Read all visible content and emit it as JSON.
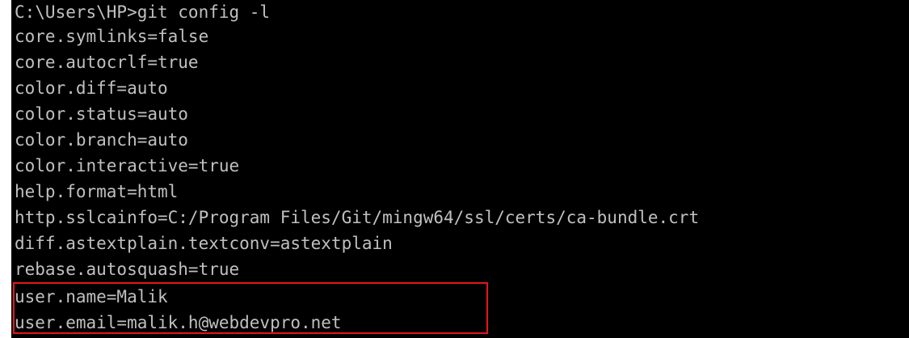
{
  "window": {
    "background_color": "#000000",
    "text_color": "#c0c0c0",
    "highlight_color": "#e8141c"
  },
  "terminal": {
    "lines": [
      "C:\\Users\\HP>git config -l",
      "core.symlinks=false",
      "core.autocrlf=true",
      "color.diff=auto",
      "color.status=auto",
      "color.branch=auto",
      "color.interactive=true",
      "help.format=html",
      "http.sslcainfo=C:/Program Files/Git/mingw64/ssl/certs/ca-bundle.crt",
      "diff.astextplain.textconv=astextplain",
      "rebase.autosquash=true",
      "user.name=Malik",
      "user.email=malik.h@webdevpro.net"
    ]
  }
}
